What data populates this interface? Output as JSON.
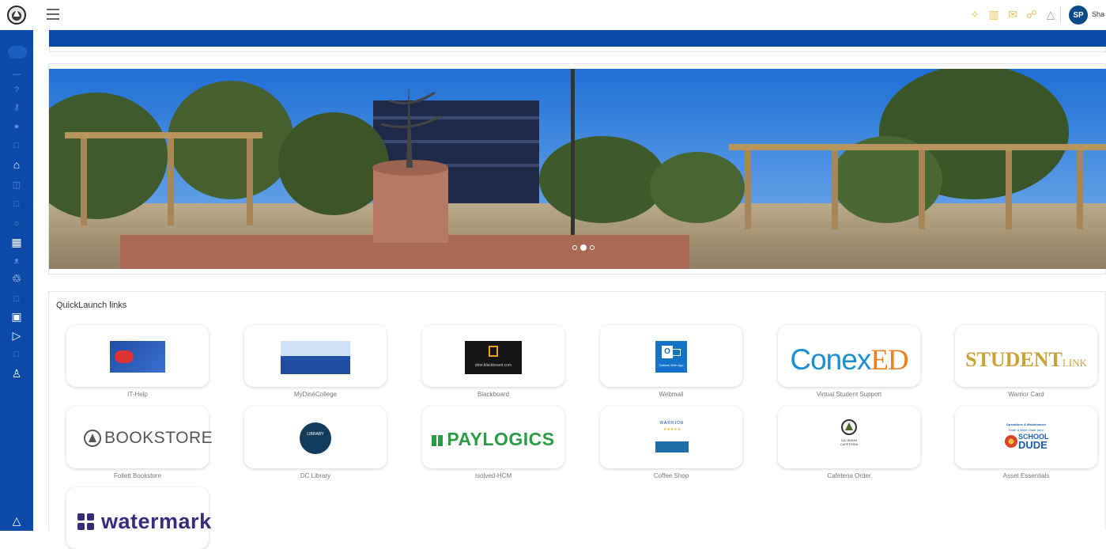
{
  "header": {
    "user_initials": "SP",
    "user_name": "Sha",
    "icons": [
      "star-icon",
      "book-icon",
      "mail-icon",
      "megaphone-icon",
      "bell-icon"
    ]
  },
  "sidebar": {
    "icons": [
      "search-icon",
      "dash-icon",
      "help-icon",
      "key-icon",
      "globe-icon",
      "square-icon",
      "home-icon",
      "columns-icon",
      "square-icon",
      "sun-icon",
      "building-icon",
      "people-icon",
      "recycle-icon",
      "square-icon",
      "calendar-icon",
      "play-icon",
      "square-icon",
      "user-icon",
      "bell-icon"
    ]
  },
  "hero": {
    "slides": 3,
    "active_slide": 2
  },
  "quicklaunch": {
    "title": "QuickLaunch links",
    "items": [
      {
        "label": "IT-Help"
      },
      {
        "label": "MyDinéCollege"
      },
      {
        "label": "Blackboard",
        "logo_text": "dine.blackboard.com",
        "logo_badge": "19+"
      },
      {
        "label": "Webmail",
        "logo_text": "Outlook Web App",
        "logo_badge": "O"
      },
      {
        "label": "Virtual Student Support",
        "logo_text_a": "Conex",
        "logo_text_b": "ED"
      },
      {
        "label": "Warrior Card",
        "logo_text_a": "STUDENT",
        "logo_text_b": "LINK"
      },
      {
        "label": "Follett Bookstore",
        "logo_text": "BOOKSTORE"
      },
      {
        "label": "DC Library",
        "logo_text": "LIBRARY"
      },
      {
        "label": "Isolved-HCM",
        "logo_text": "PAYLOGICS"
      },
      {
        "label": "Coffee Shop",
        "logo_text": "WARRIOR"
      },
      {
        "label": "Cafeteria Order",
        "logo_text": "DA' ADANI CAFETERIA"
      },
      {
        "label": "Asset Essentials",
        "logo_line1": "Operations & Maintenance",
        "logo_line2": "Enter a Work Order here",
        "logo_text_a": "SCHOOL",
        "logo_text_b": "DUDE"
      },
      {
        "label": "",
        "logo_text": "watermark"
      }
    ]
  },
  "colors": {
    "brand_blue": "#0b4aa8",
    "accent_gold": "#e8c35c",
    "avatar_bg": "#0b4a8a"
  }
}
